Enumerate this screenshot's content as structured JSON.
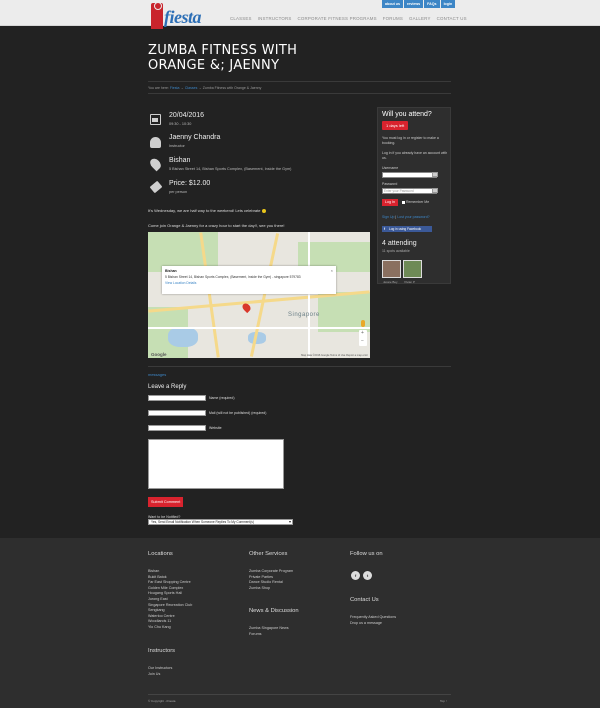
{
  "header": {
    "logo_text": "fiesta",
    "top_links": [
      "about us",
      "reviews",
      "FAQs",
      "login"
    ],
    "nav": [
      "CLASSES",
      "INSTRUCTORS",
      "CORPORATE FITNESS PROGRAMS",
      "FORUMS",
      "GALLERY",
      "CONTACT US"
    ]
  },
  "page": {
    "title_line1": "ZUMBA FITNESS WITH",
    "title_line2": "ORANGE &; JAENNY",
    "breadcrumb": {
      "prefix": "You are here:",
      "home": "Fiesta",
      "sep": "→",
      "classes": "Classes",
      "current": "Zumba Fitness with Orange & Jaenny"
    }
  },
  "event": {
    "date": "20/04/2016",
    "time": "09:30 - 10:30",
    "instructor": "Jaenny Chandra",
    "instructor_role": "Instructor",
    "venue": "Bishan",
    "address": "5 Bishan Street 14, Bishan Sports Complex, (Basement, Inside the Gym)",
    "price": "Price: $12.00",
    "price_unit": "per person",
    "desc1": "It's Wednesday, we are half way to the weekend! Lets celebrate",
    "desc2": "Come join Orange & Jaenny for a crazy hour to start the day!!, see you there!"
  },
  "map": {
    "popup_title": "Bishan",
    "popup_address": "5 Bishan Street 14, Bishan Sports Complex, (Basement, Inside the Gym) - singapore 579783",
    "popup_link": "View Location Details",
    "area_label": "Singapore",
    "google": "Google",
    "copyright": "Map data ©2016 Google   Terms of Use   Report a map error"
  },
  "sidebar": {
    "heading": "Will you attend?",
    "days_left": "1 days left",
    "info1": "You must log in or register to make a booking.",
    "info2": "Log in if you already have an account with us.",
    "username_label": "Username",
    "password_label": "Password",
    "password_placeholder": "Enter your Password",
    "login_btn": "Log In",
    "remember": "Remember Me",
    "signup": "Sign Up",
    "lost_pw": "Lost your password?",
    "fb_btn": "Log in using Facebook",
    "attending": "4 attending",
    "spots": "11 spots available",
    "attendees": [
      "Jessie Bey",
      "Vivian P"
    ]
  },
  "comments": {
    "messages": "messages",
    "leave_reply": "Leave a Reply",
    "name_label": "Name (required)",
    "mail_label": "Mail (will not be published) (required)",
    "website_label": "Website",
    "submit": "Submit Comment",
    "notify_label": "Want to be Notified?",
    "notify_value": "Yes, Send Email Notification When Someone Replies To My Comment(s)"
  },
  "footer": {
    "locations_title": "Locations",
    "locations": [
      "Bishan",
      "Bukit Batok",
      "Far East Shopping Centre",
      "Golden Mile Complex",
      "Hougang Sports Hall",
      "Jurong East",
      "Singapore Recreation Club",
      "Sengkang",
      "Waterloo Centre",
      "Woodlands 11",
      "Yio Chu Kang"
    ],
    "other_title": "Other Services",
    "other": [
      "Zumba Corporate Program",
      "Private Parties",
      "Dance Studio Rental",
      "Zumba Shop"
    ],
    "news_title": "News & Discussion",
    "news": [
      "Zumba Singapore News",
      "Forums"
    ],
    "follow_title": "Follow us on",
    "social": [
      "f",
      "t"
    ],
    "contact_title": "Contact Us",
    "contact": [
      "Frequently Asked Questions",
      "Drop us a message"
    ],
    "instructors_title": "Instructors",
    "instructors": [
      "Our Instructors",
      "Join Us"
    ],
    "copyright": "© Copyright - iFiesta",
    "top": "Top ↑"
  }
}
